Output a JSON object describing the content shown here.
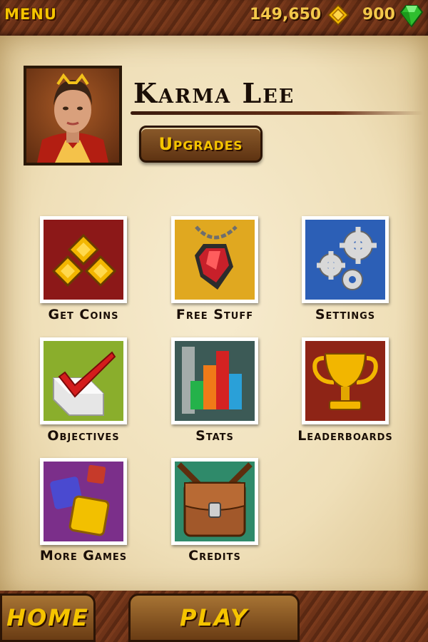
{
  "header": {
    "menu_label": "MENU",
    "coins": "149,650",
    "gems": "900",
    "coin_icon": "coin-diamond-icon",
    "gem_icon": "green-gem-icon"
  },
  "profile": {
    "player_name": "Karma Lee",
    "upgrades_label": "Upgrades"
  },
  "menu_tiles": [
    {
      "label": "Get Coins",
      "icon": "coins-icon"
    },
    {
      "label": "Free Stuff",
      "icon": "ruby-amulet-icon"
    },
    {
      "label": "Settings",
      "icon": "gears-icon"
    },
    {
      "label": "Objectives",
      "icon": "checkmark-icon"
    },
    {
      "label": "Stats",
      "icon": "bar-chart-icon"
    },
    {
      "label": "Leaderboards",
      "icon": "trophy-icon"
    },
    {
      "label": "More Games",
      "icon": "game-blocks-icon"
    },
    {
      "label": "Credits",
      "icon": "satchel-icon"
    }
  ],
  "footer": {
    "home_label": "HOME",
    "play_label": "PLAY"
  },
  "colors": {
    "accent_gold": "#f5c400",
    "parchment": "#efdfb8",
    "wood_dark": "#5a2812"
  }
}
